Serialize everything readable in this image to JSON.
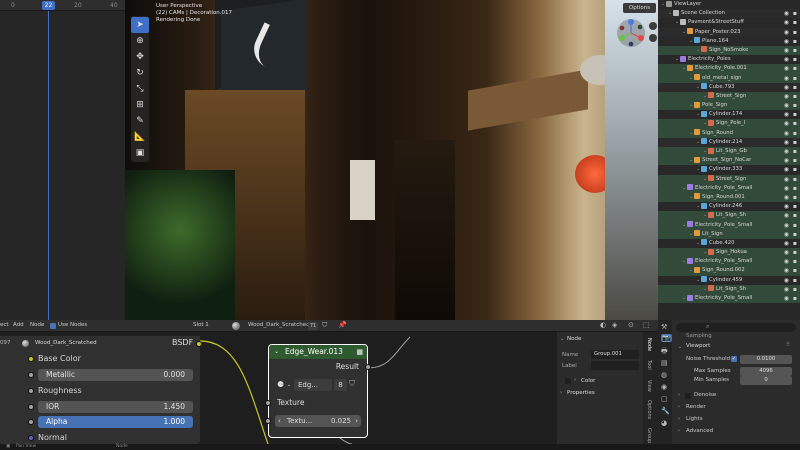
{
  "timeline": {
    "ticks": [
      "0",
      "20",
      "40"
    ],
    "current_frame": "22"
  },
  "viewport": {
    "overlay_line1": "User Perspective",
    "overlay_line2": "(22) CAMs | Decoration.017",
    "overlay_line3": "Rendering Done",
    "options_label": "Options",
    "gizmo_labels": {
      "x": "X",
      "y": "Y",
      "z": "Z"
    }
  },
  "outliner": {
    "rows": [
      {
        "label": "ViewLayer",
        "indent": 0,
        "icon": "view-layer-icon",
        "color": "#9a9a9a",
        "sel": false
      },
      {
        "label": "Scene Collection",
        "indent": 1,
        "icon": "collection-icon",
        "color": "#bbbbbb",
        "sel": false
      },
      {
        "label": "Pavment&StreetStuff",
        "indent": 2,
        "icon": "collection-icon",
        "color": "#bbbbbb",
        "sel": false
      },
      {
        "label": "Paper_Poster.023",
        "indent": 3,
        "icon": "object-icon",
        "color": "#e39a3b",
        "sel": false
      },
      {
        "label": "Plane.164",
        "indent": 4,
        "icon": "mesh-icon",
        "color": "#58a7d6",
        "sel": false
      },
      {
        "label": "Sign_NoSmoke",
        "indent": 5,
        "icon": "material-icon",
        "color": "#d46a4a",
        "sel": true
      },
      {
        "label": "Electricity_Poles",
        "indent": 2,
        "icon": "collection-icon",
        "color": "#9b7be0",
        "sel": false
      },
      {
        "label": "Electricity_Pole.001",
        "indent": 3,
        "icon": "object-icon",
        "color": "#e39a3b",
        "sel": true
      },
      {
        "label": "old_metal_sign",
        "indent": 4,
        "icon": "object-icon",
        "color": "#e39a3b",
        "sel": true
      },
      {
        "label": "Cube.793",
        "indent": 5,
        "icon": "mesh-icon",
        "color": "#58a7d6",
        "sel": false
      },
      {
        "label": "Street_Sign",
        "indent": 6,
        "icon": "material-icon",
        "color": "#d46a4a",
        "sel": true
      },
      {
        "label": "Pole_Sign",
        "indent": 4,
        "icon": "object-icon",
        "color": "#e39a3b",
        "sel": true
      },
      {
        "label": "Cylinder.174",
        "indent": 5,
        "icon": "mesh-icon",
        "color": "#58a7d6",
        "sel": false
      },
      {
        "label": "Sign_Pole_I",
        "indent": 6,
        "icon": "material-icon",
        "color": "#d46a4a",
        "sel": true
      },
      {
        "label": "Sign_Round",
        "indent": 4,
        "icon": "object-icon",
        "color": "#e39a3b",
        "sel": true
      },
      {
        "label": "Cylinder.214",
        "indent": 5,
        "icon": "mesh-icon",
        "color": "#58a7d6",
        "sel": false
      },
      {
        "label": "Lit_Sign_Gb",
        "indent": 6,
        "icon": "material-icon",
        "color": "#d46a4a",
        "sel": true
      },
      {
        "label": "Street_Sign_NoCar",
        "indent": 4,
        "icon": "object-icon",
        "color": "#e39a3b",
        "sel": true
      },
      {
        "label": "Cylinder.333",
        "indent": 5,
        "icon": "mesh-icon",
        "color": "#58a7d6",
        "sel": false
      },
      {
        "label": "Street_Sign",
        "indent": 6,
        "icon": "material-icon",
        "color": "#d46a4a",
        "sel": true
      },
      {
        "label": "Electricity_Pole_Small",
        "indent": 3,
        "icon": "object-icon",
        "color": "#9b7be0",
        "sel": true
      },
      {
        "label": "Sign_Round.001",
        "indent": 4,
        "icon": "object-icon",
        "color": "#e39a3b",
        "sel": true
      },
      {
        "label": "Cylinder.246",
        "indent": 5,
        "icon": "mesh-icon",
        "color": "#58a7d6",
        "sel": false
      },
      {
        "label": "Lit_Sign_Sh",
        "indent": 6,
        "icon": "material-icon",
        "color": "#d46a4a",
        "sel": true
      },
      {
        "label": "Electricity_Pole_Small",
        "indent": 3,
        "icon": "object-icon",
        "color": "#9b7be0",
        "sel": true
      },
      {
        "label": "Lit_Sign",
        "indent": 4,
        "icon": "object-icon",
        "color": "#e39a3b",
        "sel": true
      },
      {
        "label": "Cube.420",
        "indent": 5,
        "icon": "mesh-icon",
        "color": "#58a7d6",
        "sel": false
      },
      {
        "label": "Sign_Hokua",
        "indent": 6,
        "icon": "material-icon",
        "color": "#d46a4a",
        "sel": true
      },
      {
        "label": "Electricity_Pole_Small",
        "indent": 3,
        "icon": "object-icon",
        "color": "#9b7be0",
        "sel": true
      },
      {
        "label": "Sign_Round.002",
        "indent": 4,
        "icon": "object-icon",
        "color": "#e39a3b",
        "sel": true
      },
      {
        "label": "Cylinder.459",
        "indent": 5,
        "icon": "mesh-icon",
        "color": "#58a7d6",
        "sel": false
      },
      {
        "label": "Lit_Sign_Sh",
        "indent": 6,
        "icon": "material-icon",
        "color": "#d46a4a",
        "sel": true
      },
      {
        "label": "Electricity_Pole_Small",
        "indent": 3,
        "icon": "object-icon",
        "color": "#9b7be0",
        "sel": true
      }
    ]
  },
  "node_header": {
    "menu_items": [
      "ect",
      "Add",
      "Node"
    ],
    "use_nodes": "Use Nodes",
    "slot": "Slot 1",
    "material": "Wood_Dark_Scratched",
    "users": "71"
  },
  "bsdf_node": {
    "frame_prefix": "097",
    "material_name": "Wood_Dark_Scratched",
    "output_label": "BSDF",
    "base_color": "Base Color",
    "metallic_label": "Metallic",
    "metallic_value": "0.000",
    "roughness": "Roughness",
    "ior_label": "IOR",
    "ior_value": "1.450",
    "alpha_label": "Alpha",
    "alpha_value": "1.000",
    "normal": "Normal"
  },
  "edge_node": {
    "title": "Edge_Wear.013",
    "result": "Result",
    "group_name": "Edg...",
    "user_count": "8",
    "texture_label": "Texture",
    "texture_field": "Textu...",
    "texture_value": "0.025"
  },
  "node_panel": {
    "section": "Node",
    "name_label": "Name",
    "name_value": "Group.001",
    "label_label": "Label",
    "color_label": "Color",
    "properties_label": "Properties",
    "tabs": [
      "Node",
      "Tool",
      "View",
      "Options",
      "Group"
    ]
  },
  "properties": {
    "sampling": "Sampling",
    "viewport": "Viewport",
    "noise_threshold_label": "Noise Threshold",
    "noise_threshold_value": "0.0100",
    "max_samples_label": "Max Samples",
    "max_samples_value": "4096",
    "min_samples_label": "Min Samples",
    "min_samples_value": "0",
    "denoise": "Denoise",
    "render": "Render",
    "lights": "Lights",
    "advanced": "Advanced"
  },
  "statusbar": {
    "left": "Pan View",
    "mid": "Node"
  },
  "colors": {
    "accent": "#4772b3",
    "node_header_green": "#2f5a2f",
    "socket_yellow": "#c7c729",
    "socket_gray": "#a1a1a1",
    "socket_blue": "#6363c7"
  }
}
